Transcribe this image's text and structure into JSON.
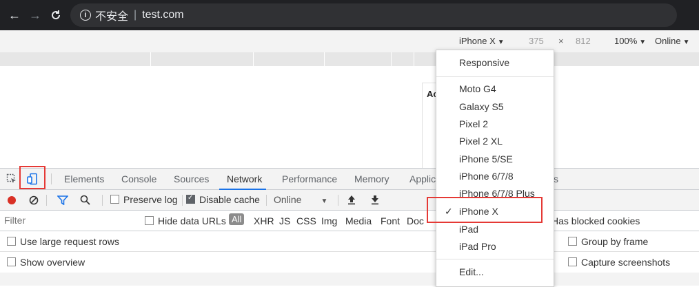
{
  "browser": {
    "security_label": "不安全",
    "separator": "|",
    "url": "test.com"
  },
  "device_toolbar": {
    "device": "iPhone X",
    "width": "375",
    "times": "×",
    "height": "812",
    "zoom": "100%",
    "throttle": "Online"
  },
  "page": {
    "partial_heading": "Ac"
  },
  "devtools": {
    "tabs": [
      {
        "label": "Elements"
      },
      {
        "label": "Console"
      },
      {
        "label": "Sources"
      },
      {
        "label": "Network"
      },
      {
        "label": "Performance"
      },
      {
        "label": "Memory"
      },
      {
        "label": "Applic"
      },
      {
        "label": "s"
      }
    ],
    "network_toolbar": {
      "preserve_log": "Preserve log",
      "disable_cache": "Disable cache",
      "throttle": "Online"
    },
    "filter": {
      "placeholder": "Filter",
      "hide_data_urls": "Hide data URLs",
      "all": "All",
      "types": [
        "XHR",
        "JS",
        "CSS",
        "Img",
        "Media",
        "Font",
        "Doc"
      ],
      "blocked_cookies": "Has blocked cookies"
    },
    "options": {
      "large_rows": "Use large request rows",
      "group_by_frame": "Group by frame",
      "show_overview": "Show overview",
      "capture_screenshots": "Capture screenshots"
    }
  },
  "dropdown": {
    "responsive": "Responsive",
    "devices": [
      "Moto G4",
      "Galaxy S5",
      "Pixel 2",
      "Pixel 2 XL",
      "iPhone 5/SE",
      "iPhone 6/7/8",
      "iPhone 6/7/8 Plus",
      "iPhone X",
      "iPad",
      "iPad Pro"
    ],
    "checkmark": "✓",
    "edit": "Edit..."
  },
  "colors": {
    "accent": "#1a73e8",
    "highlight": "#e53935",
    "record": "#d93025"
  }
}
